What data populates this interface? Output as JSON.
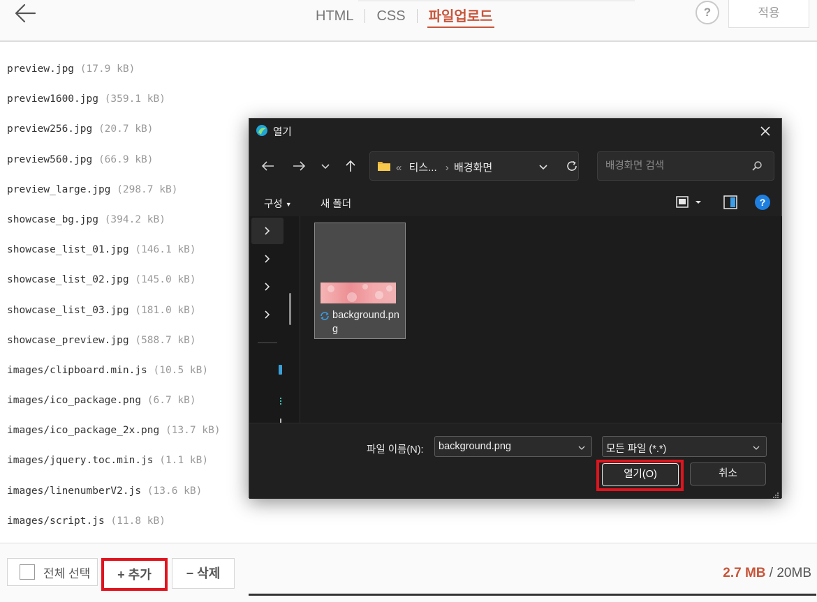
{
  "header": {
    "tabs": [
      {
        "label": "HTML"
      },
      {
        "label": "CSS"
      },
      {
        "label": "파일업로드"
      }
    ],
    "help_label": "?",
    "apply_label": "적용",
    "accent_color": "#c8553a"
  },
  "files": [
    {
      "name": "preview.jpg",
      "size": "(17.9 kB)"
    },
    {
      "name": "preview1600.jpg",
      "size": "(359.1 kB)"
    },
    {
      "name": "preview256.jpg",
      "size": "(20.7 kB)"
    },
    {
      "name": "preview560.jpg",
      "size": "(66.9 kB)"
    },
    {
      "name": "preview_large.jpg",
      "size": "(298.7 kB)"
    },
    {
      "name": "showcase_bg.jpg",
      "size": "(394.2 kB)"
    },
    {
      "name": "showcase_list_01.jpg",
      "size": "(146.1 kB)"
    },
    {
      "name": "showcase_list_02.jpg",
      "size": "(145.0 kB)"
    },
    {
      "name": "showcase_list_03.jpg",
      "size": "(181.0 kB)"
    },
    {
      "name": "showcase_preview.jpg",
      "size": "(588.7 kB)"
    },
    {
      "name": "images/clipboard.min.js",
      "size": "(10.5 kB)"
    },
    {
      "name": "images/ico_package.png",
      "size": "(6.7 kB)"
    },
    {
      "name": "images/ico_package_2x.png",
      "size": "(13.7 kB)"
    },
    {
      "name": "images/jquery.toc.min.js",
      "size": "(1.1 kB)"
    },
    {
      "name": "images/linenumberV2.js",
      "size": "(13.6 kB)"
    },
    {
      "name": "images/script.js",
      "size": "(11.8 kB)"
    }
  ],
  "footer": {
    "select_all_label": "전체 선택",
    "add_label": "+ 추가",
    "delete_label": "− 삭제",
    "storage_used": "2.7 MB",
    "storage_total": "/ 20MB"
  },
  "dialog": {
    "title": "열기",
    "breadcrumb": {
      "prefix": "«",
      "parent": "티스...",
      "separator": "›",
      "current": "배경화면"
    },
    "search_placeholder": "배경화면 검색",
    "commands": {
      "organize_label": "구성",
      "new_folder_label": "새 폴더",
      "help_label": "?"
    },
    "items": [
      {
        "name": "background.png"
      }
    ],
    "file_name_label": "파일 이름(N):",
    "file_name_value": "background.png",
    "file_type_value": "모든 파일 (*.*)",
    "open_label": "열기(O)",
    "cancel_label": "취소",
    "highlight_color": "#e0141e"
  }
}
